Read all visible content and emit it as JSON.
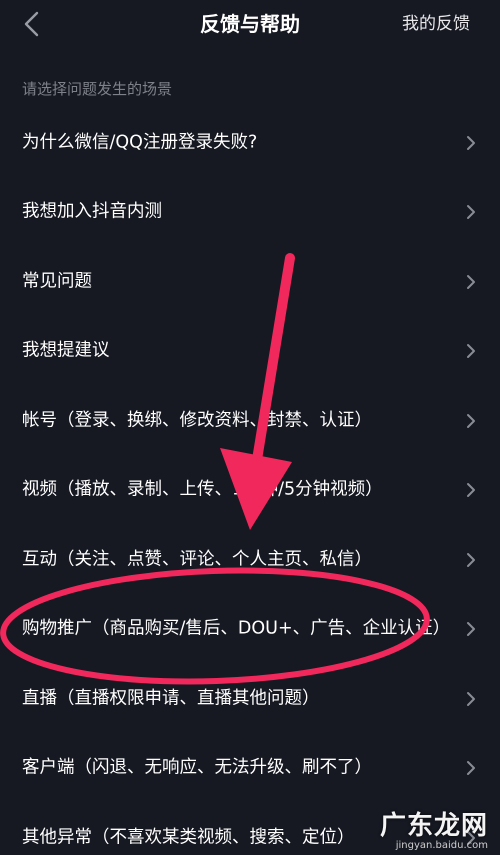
{
  "header": {
    "title": "反馈与帮助",
    "right_action": "我的反馈",
    "back_icon": "chevron-left-icon"
  },
  "section_label": "请选择问题发生的场景",
  "items": [
    {
      "label": "为什么微信/QQ注册登录失败?"
    },
    {
      "label": "我想加入抖音内测"
    },
    {
      "label": "常见问题"
    },
    {
      "label": "我想提建议"
    },
    {
      "label": "帐号（登录、换绑、修改资料、封禁、认证）"
    },
    {
      "label": "视频（播放、录制、上传、1分钟/5分钟视频）"
    },
    {
      "label": "互动（关注、点赞、评论、个人主页、私信）"
    },
    {
      "label": "购物推广（商品购买/售后、DOU+、广告、企业认证）"
    },
    {
      "label": "直播（直播权限申请、直播其他问题）"
    },
    {
      "label": "客户端（闪退、无响应、无法升级、刷不了）"
    },
    {
      "label": "其他异常（不喜欢某类视频、搜索、定位）"
    }
  ],
  "watermark": {
    "main": "广东龙网",
    "sub": "jingyan.baidu.com"
  },
  "colors": {
    "background": "#161822",
    "text": "#ffffff",
    "muted": "#7e808a",
    "chevron": "#8a8c95",
    "annotation": "#f0285c"
  }
}
